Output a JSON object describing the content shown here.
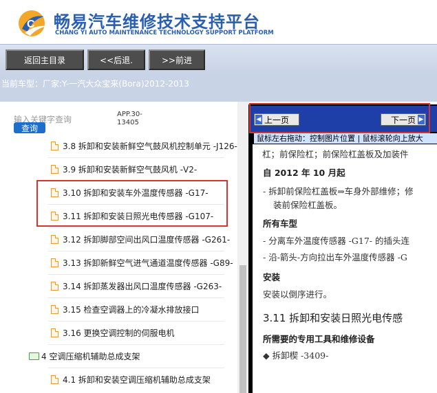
{
  "header": {
    "title_cn": "畅易汽车维修技术支持平台",
    "title_en": "CHANG YI AUTO MAINTENANCE TECHNOLOGY SUPPORT PLATFORM",
    "logo_icon": "cy-logo-icon"
  },
  "toolbar": {
    "home_label": "返回主目录",
    "back_label": "<<后退.",
    "forward_label": ">>前进"
  },
  "model": {
    "label": "当前车型：",
    "value": "厂家:Y-一汽大众宝来(Bora)2012-2013"
  },
  "search": {
    "placeholder": "输入关键字查询",
    "button_label": "查询",
    "app_code": "APP.30-13405"
  },
  "tree": {
    "items": [
      {
        "label": "3.8 拆卸和安装新鲜空气鼓风机控制单元 -J126-",
        "icon": "file-icon"
      },
      {
        "label": "3.9 拆卸和安装新鲜空气鼓风机 -V2-",
        "icon": "file-icon"
      },
      {
        "label": "3.10 拆卸和安装车外温度传感器 -G17-",
        "icon": "file-icon"
      },
      {
        "label": "3.11 拆卸和安装日照光电传感器 -G107-",
        "icon": "file-icon"
      },
      {
        "label": "3.12 拆卸脚部空间出风口温度传感器 -G261-",
        "icon": "file-icon"
      },
      {
        "label": "3.13 拆卸新鲜空气进气通道温度传感器 -G89-",
        "icon": "file-icon"
      },
      {
        "label": "3.14 拆卸蒸发器出风口温度传感器 -G263-",
        "icon": "file-icon"
      },
      {
        "label": "3.15 检查空调器上的冷凝水排放接口",
        "icon": "file-icon"
      },
      {
        "label": "3.16 更换空调控制的伺服电机",
        "icon": "file-icon"
      },
      {
        "label": "4 空调压缩机辅助总成支架",
        "icon": "folder-icon"
      },
      {
        "label": "4.1 拆卸和安装空调压缩机辅助总成支架",
        "icon": "file-icon"
      }
    ]
  },
  "viewer": {
    "prev_label": "上一页",
    "next_label": "下一页",
    "hint": "鼠标左右拖动：控制图片位置 | 鼠标滚轮向上放大",
    "lines": [
      "杠；前保险杠；前保险杠盖板及加装件",
      "自 2012 年 10 月起",
      "- 拆卸前保险杠盖板⇒车身外部维修；修",
      "装前保险杠盖板。",
      "所有车型",
      "- 分离车外温度传感器 -G17- 的插头连",
      "- 沿-箭头-方向拉出车外温度传感器 -G",
      "安装",
      "安装以倒序进行。",
      "3.11 拆卸和安装日照光电传感",
      "所需要的专用工具和维修设备",
      "◆ 拆卸楔 -3409-"
    ],
    "top_fragment": "杠；前保险杠；前保险杠盖板及加装件"
  }
}
